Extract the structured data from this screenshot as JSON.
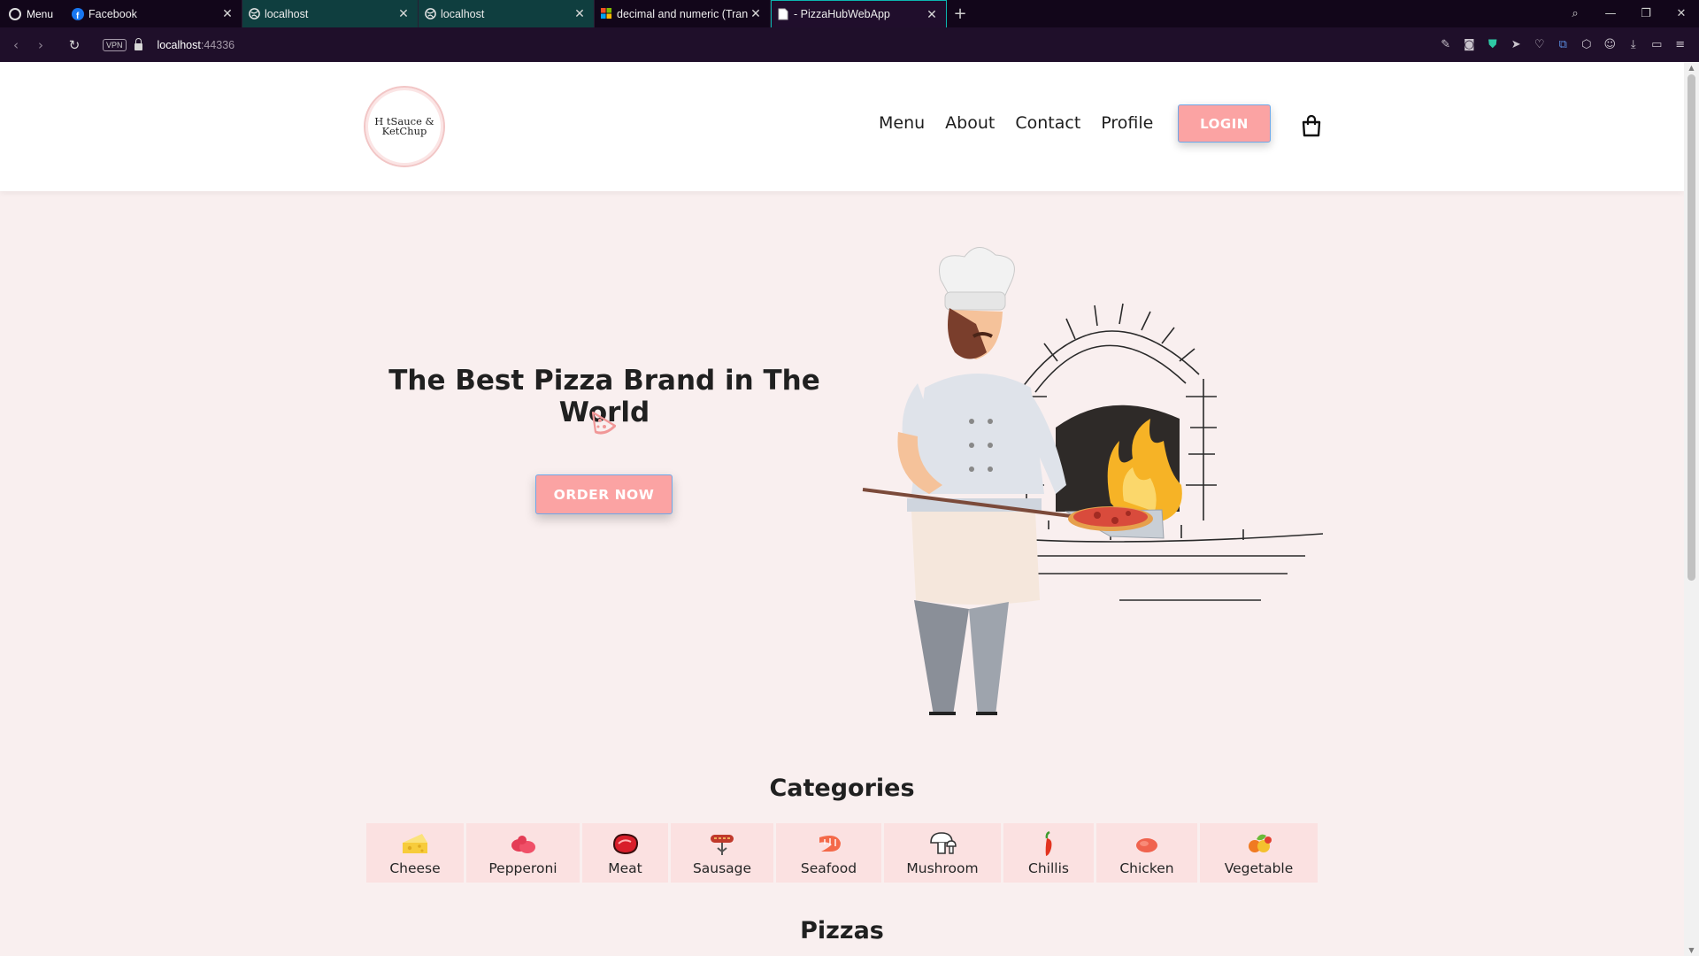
{
  "browser": {
    "menu_label": "Menu",
    "tabs": [
      {
        "title": "Facebook",
        "icon": "facebook-icon"
      },
      {
        "title": "localhost",
        "icon": "globe-icon"
      },
      {
        "title": "localhost",
        "icon": "globe-icon"
      },
      {
        "title": "decimal and numeric (Tran",
        "icon": "microsoft-icon"
      },
      {
        "title": "- PizzaHubWebApp",
        "icon": "document-icon"
      }
    ],
    "vpn_label": "VPN",
    "url_host": "localhost",
    "url_port": ":44336"
  },
  "site": {
    "logo_text_line1": "H  tSauce &",
    "logo_text_line2": "KetChup",
    "nav": [
      "Menu",
      "About",
      "Contact",
      "Profile"
    ],
    "login_label": "LOGIN",
    "hero_title": "The Best Pizza Brand in The World",
    "order_label": "ORDER NOW",
    "categories_title": "Categories",
    "categories": [
      {
        "label": "Cheese",
        "icon": "cheese-icon"
      },
      {
        "label": "Pepperoni",
        "icon": "pepperoni-icon"
      },
      {
        "label": "Meat",
        "icon": "meat-icon"
      },
      {
        "label": "Sausage",
        "icon": "sausage-icon"
      },
      {
        "label": "Seafood",
        "icon": "shrimp-icon"
      },
      {
        "label": "Mushroom",
        "icon": "mushroom-icon"
      },
      {
        "label": "Chillis",
        "icon": "chilli-icon"
      },
      {
        "label": "Chicken",
        "icon": "chicken-icon"
      },
      {
        "label": "Vegetable",
        "icon": "vegetable-icon"
      }
    ],
    "pizzas_title": "Pizzas"
  },
  "colors": {
    "accent": "#fba3a3",
    "page_bg": "#f9efef",
    "category_bg": "#fbe1e1"
  }
}
